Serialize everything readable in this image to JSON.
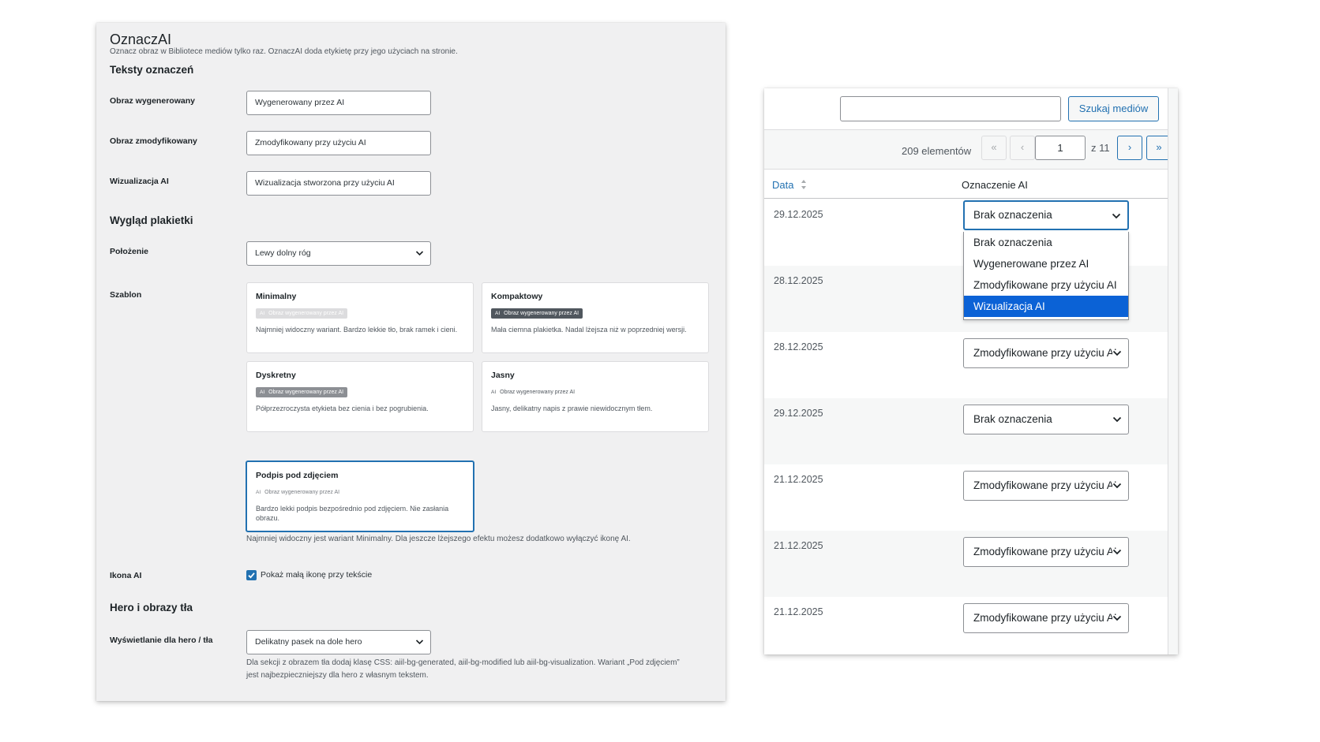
{
  "settings": {
    "title": "OznaczAI",
    "subtitle": "Oznacz obraz w Bibliotece mediów tylko raz. OznaczAI doda etykietę przy jego użyciach na stronie.",
    "section_texts": "Teksty oznaczeń",
    "label_generated": "Obraz wygenerowany",
    "value_generated": "Wygenerowany przez AI",
    "label_modified": "Obraz zmodyfikowany",
    "value_modified": "Zmodyfikowany przy użyciu AI",
    "label_visualization": "Wizualizacja AI",
    "value_visualization": "Wizualizacja stworzona przy użyciu AI",
    "section_badge": "Wygląd plakietki",
    "label_position": "Położenie",
    "value_position": "Lewy dolny róg",
    "label_template": "Szablon",
    "templates": [
      {
        "title": "Minimalny",
        "badge_ai": "AI",
        "badge": "Obraz wygenerowany przez AI",
        "desc": "Najmniej widoczny wariant. Bardzo lekkie tło, brak ramek i cieni."
      },
      {
        "title": "Kompaktowy",
        "badge_ai": "AI",
        "badge": "Obraz wygenerowany przez AI",
        "desc": "Mała ciemna plakietka. Nadal lżejsza niż w poprzedniej wersji."
      },
      {
        "title": "Dyskretny",
        "badge_ai": "AI",
        "badge": "Obraz wygenerowany przez AI",
        "desc": "Półprzezroczysta etykieta bez cienia i bez pogrubienia."
      },
      {
        "title": "Jasny",
        "badge_ai": "AI",
        "badge": "Obraz wygenerowany przez AI",
        "desc": "Jasny, delikatny napis z prawie niewidocznym tłem."
      },
      {
        "title": "Podpis pod zdjęciem",
        "badge_ai": "AI",
        "badge": "Obraz wygenerowany przez AI",
        "desc": "Bardzo lekki podpis bezpośrednio pod zdjęciem. Nie zasłania obrazu."
      }
    ],
    "template_help": "Najmniej widoczny jest wariant Minimalny. Dla jeszcze lżejszego efektu możesz dodatkowo wyłączyć ikonę AI.",
    "label_icon": "Ikona AI",
    "icon_checkbox_label": "Pokaż małą ikonę przy tekście",
    "icon_checked": true,
    "section_hero": "Hero i obrazy tła",
    "label_hero": "Wyświetlanie dla hero / tła",
    "value_hero": "Delikatny pasek na dole hero",
    "hero_help": "Dla sekcji z obrazem tła dodaj klasę CSS: aiil-bg-generated, aiil-bg-modified lub aiil-bg-visualization. Wariant „Pod zdjęciem” jest najbezpieczniejszy dla hero z własnym tekstem."
  },
  "media": {
    "search_placeholder": "",
    "search_button": "Szukaj mediów",
    "count": "209 elementów",
    "pager": {
      "first": "«",
      "prev": "‹",
      "current_page": "1",
      "of": "z 11",
      "next": "›",
      "last": "»"
    },
    "columns": {
      "date": "Data",
      "ai": "Oznaczenie AI"
    },
    "rows": [
      {
        "date": "29.12.2025",
        "ai": "Brak oznaczenia"
      },
      {
        "date": "28.12.2025",
        "ai": ""
      },
      {
        "date": "28.12.2025",
        "ai": "Zmodyfikowane przy użyciu AI"
      },
      {
        "date": "29.12.2025",
        "ai": "Brak oznaczenia"
      },
      {
        "date": "21.12.2025",
        "ai": "Zmodyfikowane przy użyciu AI"
      },
      {
        "date": "21.12.2025",
        "ai": "Zmodyfikowane przy użyciu AI"
      },
      {
        "date": "21.12.2025",
        "ai": "Zmodyfikowane przy użyciu AI"
      }
    ],
    "dropdown_options": [
      "Brak oznaczenia",
      "Wygenerowane przez AI",
      "Zmodyfikowane przy użyciu AI",
      "Wizualizacja AI"
    ],
    "dropdown_highlighted": "Wizualizacja AI"
  },
  "colors": {
    "accent": "#2271b1",
    "highlight": "#0b62d6",
    "panel_bg": "#f0f0f1"
  }
}
